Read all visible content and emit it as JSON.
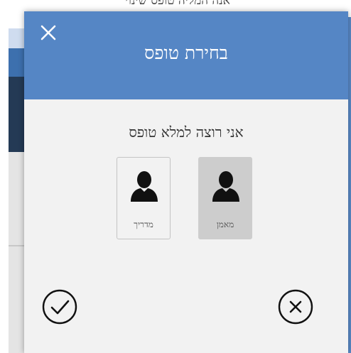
{
  "background": {
    "top_text": "אנה המליה טופס שינוי"
  },
  "modal": {
    "title": "בחירת טופס",
    "prompt": "אני רוצה למלא טופס",
    "options": [
      {
        "label": "מאמן",
        "icon": "user-silhouette-icon",
        "selected": true
      },
      {
        "label": "מדריך",
        "icon": "user-silhouette-icon",
        "selected": false
      }
    ],
    "confirm_icon": "check-circle-icon",
    "cancel_icon": "x-circle-icon",
    "close_icon": "close-icon"
  },
  "colors": {
    "header": "#5586c5",
    "modal_bg": "#f2f2f2",
    "selected_option": "#cdcdcd"
  }
}
